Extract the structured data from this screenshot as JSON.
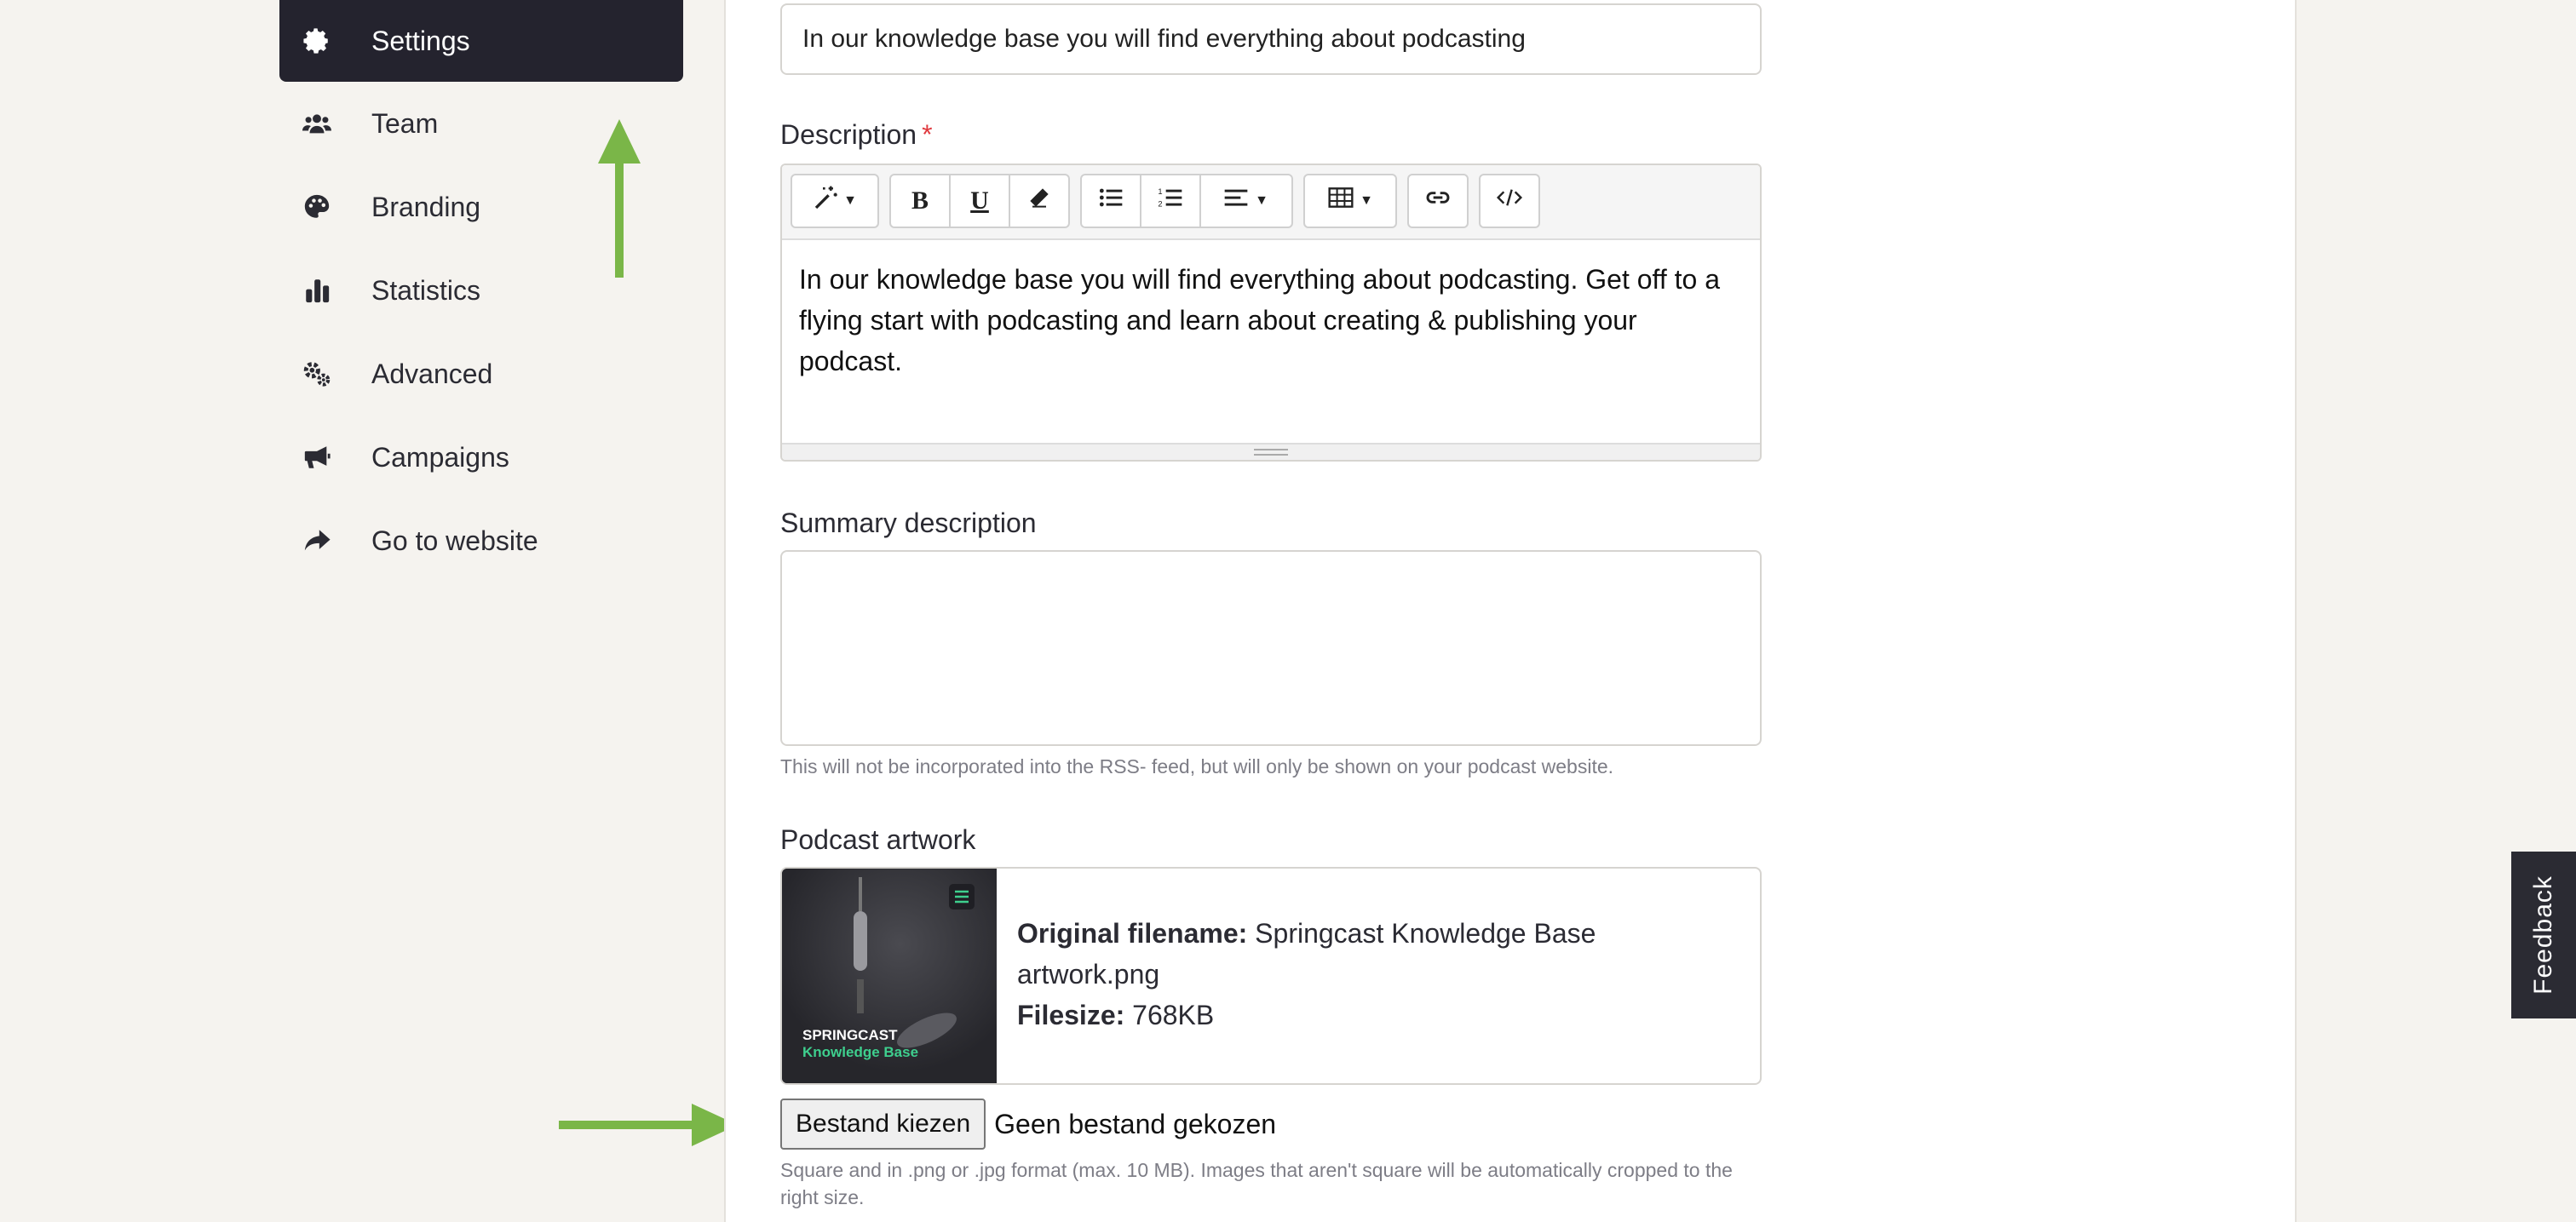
{
  "sidebar": {
    "items": [
      {
        "label": "Settings",
        "icon": "gear-icon",
        "active": true
      },
      {
        "label": "Team",
        "icon": "users-icon",
        "active": false
      },
      {
        "label": "Branding",
        "icon": "palette-icon",
        "active": false
      },
      {
        "label": "Statistics",
        "icon": "bar-chart-icon",
        "active": false
      },
      {
        "label": "Advanced",
        "icon": "gears-icon",
        "active": false
      },
      {
        "label": "Campaigns",
        "icon": "megaphone-icon",
        "active": false
      },
      {
        "label": "Go to website",
        "icon": "share-arrow-icon",
        "active": false
      }
    ]
  },
  "form": {
    "title_value": "In our knowledge base you will find everything about podcasting",
    "description": {
      "label": "Description",
      "required_mark": "*",
      "text": "In our knowledge base you will find everything about podcasting. Get off to a flying start with podcasting and learn about creating & publishing your podcast."
    },
    "summary": {
      "label": "Summary description",
      "value": "",
      "help": "This will not be incorporated into the RSS- feed, but will only be shown on your podcast website."
    },
    "artwork": {
      "label": "Podcast artwork",
      "image_text_line1": "SPRINGCAST",
      "image_text_line2": "Knowledge Base",
      "filename_label": "Original filename:",
      "filename_value": "Springcast Knowledge Base artwork.png",
      "filesize_label": "Filesize:",
      "filesize_value": "768KB",
      "choose_button": "Bestand kiezen",
      "no_file": "Geen bestand gekozen",
      "help": "Square and in .png or .jpg format (max. 10 MB). Images that aren't square will be automatically cropped to the right size."
    }
  },
  "feedback_tab": {
    "label": "Feedback"
  },
  "colors": {
    "active_bg": "#24232e",
    "annotation_arrow": "#7ab648",
    "artwork_accent": "#3ecf8e"
  }
}
